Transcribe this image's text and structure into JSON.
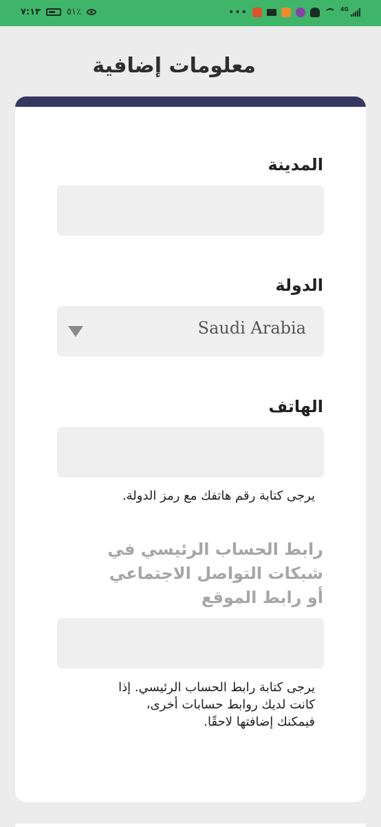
{
  "status_bar": {
    "time": "٧:١٣",
    "battery": "٥١٪",
    "dots": "•••",
    "network": "4G"
  },
  "page": {
    "title": "معلومات إضافية"
  },
  "form": {
    "city": {
      "label": "المدينة",
      "value": ""
    },
    "country": {
      "label": "الدولة",
      "selected": "Saudi Arabia"
    },
    "phone": {
      "label": "الهاتف",
      "value": "",
      "help": "يرجى كتابة رقم هاتفك مع رمز الدولة."
    },
    "social": {
      "label_line1": "رابط الحساب الرئيسي في",
      "label_line2": "شبكات التواصل الاجتماعي",
      "label_line3": "أو رابط الموقع",
      "value": "",
      "help_line1": "يرجى كتابة رابط الحساب الرئيسي. إذا",
      "help_line2": "كانت لديك روابط حسابات أخرى،",
      "help_line3": "فيمكنك إضافتها لاحقًا."
    }
  },
  "colors": {
    "status_bar": "#3fb56a",
    "card_top_bar": "#363863",
    "background": "#ececec",
    "field_fill": "#efefef"
  }
}
